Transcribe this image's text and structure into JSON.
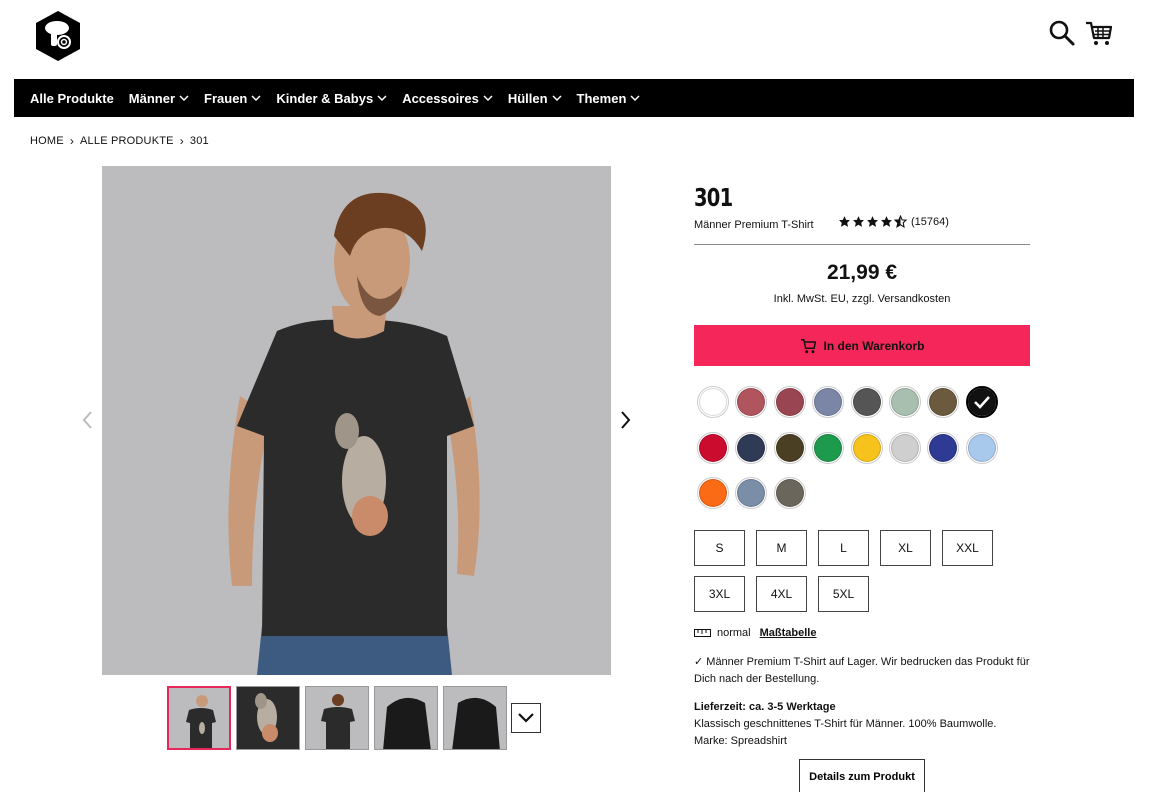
{
  "header": {
    "logo": "octopus-hexagon-logo",
    "search_icon": "search-icon",
    "cart_icon": "cart-icon"
  },
  "nav": {
    "items": [
      {
        "label": "Alle Produkte",
        "dropdown": false
      },
      {
        "label": "Männer",
        "dropdown": true
      },
      {
        "label": "Frauen",
        "dropdown": true
      },
      {
        "label": "Kinder & Babys",
        "dropdown": true
      },
      {
        "label": "Accessoires",
        "dropdown": true
      },
      {
        "label": "Hüllen",
        "dropdown": true
      },
      {
        "label": "Themen",
        "dropdown": true
      }
    ]
  },
  "breadcrumb": [
    "HOME",
    "ALLE PRODUKTE",
    "301"
  ],
  "product": {
    "title": "301",
    "type": "Männer Premium T-Shirt",
    "rating": 4.5,
    "reviews": "(15764)",
    "price": "21,99 €",
    "tax_note": "Inkl. MwSt. EU, zzgl. Versandkosten",
    "cart_label": "In den Warenkorb",
    "colors": [
      "#ffffff",
      "#b0545e",
      "#9a4652",
      "#7b85a6",
      "#555555",
      "#a8bfb0",
      "#6b5a3e",
      "#111111",
      "#cc0c2f",
      "#2f3a56",
      "#4a3f22",
      "#1e9a4d",
      "#f7c21b",
      "#cfcfcf",
      "#2e3a93",
      "#a9c9ec",
      "#fb6a14",
      "#7a8ea8",
      "#6a665c"
    ],
    "selected_color_index": 7,
    "sizes": [
      "S",
      "M",
      "L",
      "XL",
      "XXL",
      "3XL",
      "4XL",
      "5XL"
    ],
    "fit_label": "normal",
    "size_chart_label": "Maßtabelle",
    "stock_text": "Männer Premium T-Shirt auf Lager. Wir bedrucken das Produkt für Dich nach der Bestellung.",
    "delivery_title": "Lieferzeit: ca. 3-5 Werktage",
    "description": "Klassisch geschnittenes T-Shirt für Männer. 100% Baumwolle.",
    "brand": "Marke: Spreadshirt",
    "details_label": "Details zum Produkt"
  }
}
